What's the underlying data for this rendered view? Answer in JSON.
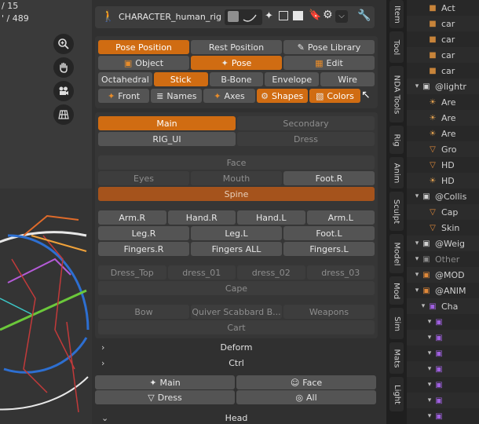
{
  "viewport": {
    "line1": "/ 15",
    "line2": "' / 489"
  },
  "rig_header": {
    "name": "CHARACTER_human_rig"
  },
  "rows": {
    "position": [
      {
        "label": "Pose Position",
        "icon": "",
        "on": true
      },
      {
        "label": "Rest Position",
        "icon": "",
        "on": false
      },
      {
        "label": "Pose Library",
        "icon": "pose-library-icon",
        "on": false
      }
    ],
    "mode": [
      {
        "label": "Object",
        "icon": "object-icon",
        "on": false
      },
      {
        "label": "Pose",
        "icon": "pose-icon",
        "on": true
      },
      {
        "label": "Edit",
        "icon": "edit-icon",
        "on": false
      }
    ],
    "display": [
      {
        "label": "Octahedral",
        "on": false
      },
      {
        "label": "Stick",
        "on": true
      },
      {
        "label": "B-Bone",
        "on": false
      },
      {
        "label": "Envelope",
        "on": false
      },
      {
        "label": "Wire",
        "on": false
      }
    ],
    "overlay": [
      {
        "label": "Front",
        "icon": "front-icon",
        "on": false
      },
      {
        "label": "Names",
        "icon": "names-icon",
        "on": false
      },
      {
        "label": "Axes",
        "icon": "axes-icon",
        "on": false
      },
      {
        "label": "Shapes",
        "icon": "shapes-icon",
        "on": true
      },
      {
        "label": "Colors",
        "icon": "colors-icon",
        "on": true
      }
    ]
  },
  "tabs_main": [
    {
      "label": "Main",
      "on": true
    },
    {
      "label": "Secondary",
      "on": false
    }
  ],
  "tabs_ui": [
    {
      "label": "RIG_UI",
      "on": false
    },
    {
      "label": "Dress",
      "on": false
    }
  ],
  "face_section": {
    "title": "Face",
    "row": [
      "Eyes",
      "Mouth",
      "Foot.R"
    ],
    "spine": "Spine"
  },
  "limbs": {
    "row1": [
      "Arm.R",
      "Hand.R",
      "Hand.L",
      "Arm.L"
    ],
    "row2": [
      "Leg.R",
      "Leg.L",
      "Foot.L"
    ],
    "row3": [
      "Fingers.R",
      "Fingers ALL",
      "Fingers.L"
    ]
  },
  "dress_section": {
    "row": [
      "Dress_Top",
      "dress_01",
      "dress_02",
      "dress_03"
    ],
    "cape": "Cape"
  },
  "weapons_section": {
    "row": [
      "Bow",
      "Quiver Scabbard B...",
      "Weapons"
    ],
    "cart": "Cart"
  },
  "panels": {
    "deform": "Deform",
    "ctrl": "Ctrl",
    "head": "Head"
  },
  "bottom_buttons": {
    "row1": [
      "Main",
      "Face"
    ],
    "row2": [
      "Dress",
      "All"
    ]
  },
  "side_tabs": [
    "Item",
    "Tool",
    "NDA Tools",
    "Rig",
    "Anim",
    "Sculpt",
    "Model",
    "Mod",
    "Sim",
    "Mats",
    "Light"
  ],
  "outliner": [
    {
      "label": "Act",
      "kind": "camera",
      "indent": 1
    },
    {
      "label": "car",
      "kind": "camera",
      "indent": 1
    },
    {
      "label": "car",
      "kind": "camera",
      "indent": 1
    },
    {
      "label": "car",
      "kind": "camera",
      "indent": 1
    },
    {
      "label": "car",
      "kind": "camera",
      "indent": 1
    },
    {
      "label": "@lightr",
      "kind": "collection",
      "indent": 0
    },
    {
      "label": "Are",
      "kind": "light",
      "indent": 1
    },
    {
      "label": "Are",
      "kind": "light",
      "indent": 1
    },
    {
      "label": "Are",
      "kind": "light",
      "indent": 1
    },
    {
      "label": "Gro",
      "kind": "cone",
      "indent": 1
    },
    {
      "label": "HD",
      "kind": "cone",
      "indent": 1
    },
    {
      "label": "HD",
      "kind": "light",
      "indent": 1
    },
    {
      "label": "@Collis",
      "kind": "collection",
      "indent": 0
    },
    {
      "label": "Cap",
      "kind": "cone",
      "indent": 1
    },
    {
      "label": "Skin",
      "kind": "cone",
      "indent": 1
    },
    {
      "label": "@Weig",
      "kind": "collection",
      "indent": 0
    },
    {
      "label": "Other",
      "kind": "collection-dim",
      "indent": 0
    },
    {
      "label": "@MOD",
      "kind": "collection-orange",
      "indent": 0
    },
    {
      "label": "@ANIM",
      "kind": "collection-orange",
      "indent": 0
    },
    {
      "label": "Cha",
      "kind": "collection-purple",
      "indent": 1
    },
    {
      "label": "",
      "kind": "collection-purple",
      "indent": 2
    },
    {
      "label": "",
      "kind": "collection-purple",
      "indent": 2
    },
    {
      "label": "",
      "kind": "collection-purple",
      "indent": 2
    },
    {
      "label": "",
      "kind": "collection-purple",
      "indent": 2
    },
    {
      "label": "",
      "kind": "collection-purple",
      "indent": 2
    },
    {
      "label": "",
      "kind": "collection-purple",
      "indent": 2
    },
    {
      "label": "",
      "kind": "collection-purple",
      "indent": 2
    }
  ]
}
